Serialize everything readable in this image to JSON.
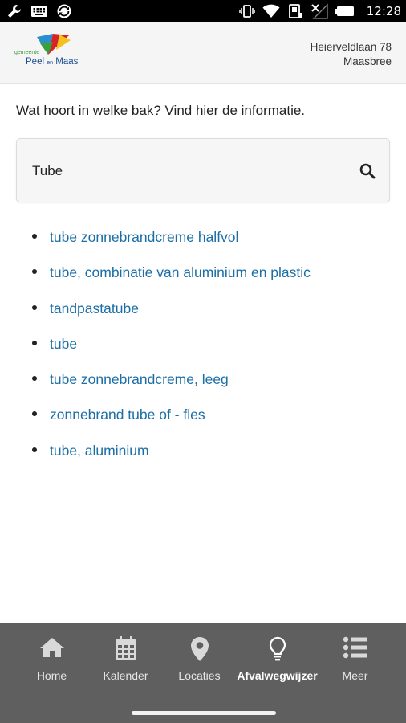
{
  "status_bar": {
    "time": "12:28",
    "left_icons": [
      "wrench-icon",
      "keyboard-icon",
      "sync-icon"
    ],
    "right_icons": [
      "vibrate-icon",
      "wifi-icon",
      "data-icon",
      "no-signal-icon",
      "battery-icon"
    ]
  },
  "header": {
    "logo": {
      "small": "gemeente",
      "main": "Peel",
      "en": "en",
      "main2": "Maas"
    },
    "address_line1": "Heierveldlaan 78",
    "address_line2": "Maasbree"
  },
  "intro": "Wat hoort in welke bak? Vind hier de informatie.",
  "search": {
    "value": "Tube",
    "icon": "search-icon"
  },
  "results": [
    "tube zonnebrandcreme halfvol",
    "tube, combinatie van aluminium en plastic",
    "tandpastatube",
    "tube",
    "tube zonnebrandcreme, leeg",
    "zonnebrand tube of - fles",
    "tube, aluminium"
  ],
  "nav": {
    "items": [
      {
        "label": "Home",
        "icon": "home-icon"
      },
      {
        "label": "Kalender",
        "icon": "calendar-icon"
      },
      {
        "label": "Locaties",
        "icon": "location-pin-icon"
      },
      {
        "label": "Afvalwegwijzer",
        "icon": "lightbulb-icon",
        "active": true
      },
      {
        "label": "Meer",
        "icon": "list-icon"
      }
    ]
  },
  "colors": {
    "link": "#1c6fa6",
    "nav_bg": "#5f5f5f",
    "header_bg": "#f5f5f5"
  }
}
